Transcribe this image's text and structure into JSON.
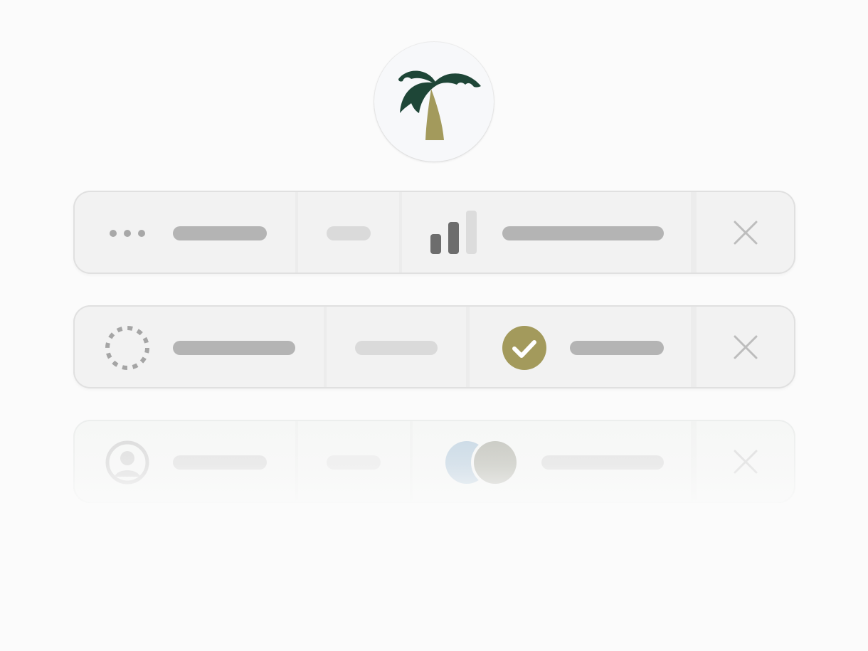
{
  "logo": {
    "icon": "palm-tree-icon",
    "colors": {
      "leaves": "#1e4637",
      "trunk": "#a39a5c",
      "background": "#f7f8fa"
    }
  },
  "rows": [
    {
      "status_icon": "more-dots-icon",
      "secondary_icon": "signal-bars-icon",
      "action_icon": "close-icon"
    },
    {
      "status_icon": "loading-spinner-icon",
      "secondary_icon": "check-circle-icon",
      "action_icon": "close-icon"
    },
    {
      "status_icon": "user-avatar-icon",
      "secondary_icon": "toggle-circles-icon",
      "action_icon": "close-icon"
    }
  ],
  "colors": {
    "check_badge": "#a39a5c",
    "placeholder_bar": "#b4b4b4",
    "placeholder_bar_light": "#dadada",
    "toggle_left": "#c5d6e3",
    "toggle_right": "#c3c4bc"
  }
}
